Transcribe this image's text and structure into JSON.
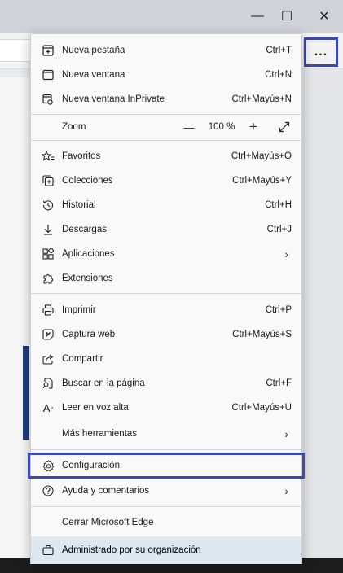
{
  "window": {
    "minimize_glyph": "—",
    "maximize_glyph": "☐",
    "close_glyph": "✕"
  },
  "toolbar": {
    "more_label": "..."
  },
  "menu": {
    "new_tab": {
      "label": "Nueva pestaña",
      "shortcut": "Ctrl+T"
    },
    "new_window": {
      "label": "Nueva ventana",
      "shortcut": "Ctrl+N"
    },
    "new_private": {
      "label": "Nueva ventana InPrivate",
      "shortcut": "Ctrl+Mayús+N"
    },
    "zoom": {
      "label": "Zoom",
      "value": "100 %",
      "minus": "—",
      "plus": "+"
    },
    "favorites": {
      "label": "Favoritos",
      "shortcut": "Ctrl+Mayús+O"
    },
    "collections": {
      "label": "Colecciones",
      "shortcut": "Ctrl+Mayús+Y"
    },
    "history": {
      "label": "Historial",
      "shortcut": "Ctrl+H"
    },
    "downloads": {
      "label": "Descargas",
      "shortcut": "Ctrl+J"
    },
    "apps": {
      "label": "Aplicaciones"
    },
    "extensions": {
      "label": "Extensiones"
    },
    "print": {
      "label": "Imprimir",
      "shortcut": "Ctrl+P"
    },
    "web_capture": {
      "label": "Captura web",
      "shortcut": "Ctrl+Mayús+S"
    },
    "share": {
      "label": "Compartir"
    },
    "find": {
      "label": "Buscar en la página",
      "shortcut": "Ctrl+F"
    },
    "read_aloud": {
      "label": "Leer en voz alta",
      "shortcut": "Ctrl+Mayús+U",
      "icon_text": "A"
    },
    "more_tools": {
      "label": "Más herramientas"
    },
    "settings": {
      "label": "Configuración"
    },
    "help": {
      "label": "Ayuda y comentarios"
    },
    "close_edge": {
      "label": "Cerrar Microsoft Edge"
    },
    "managed": {
      "label": "Administrado por su organización"
    }
  },
  "colors": {
    "highlight": "#3b48b8",
    "footer_bg": "#dde8f1"
  }
}
